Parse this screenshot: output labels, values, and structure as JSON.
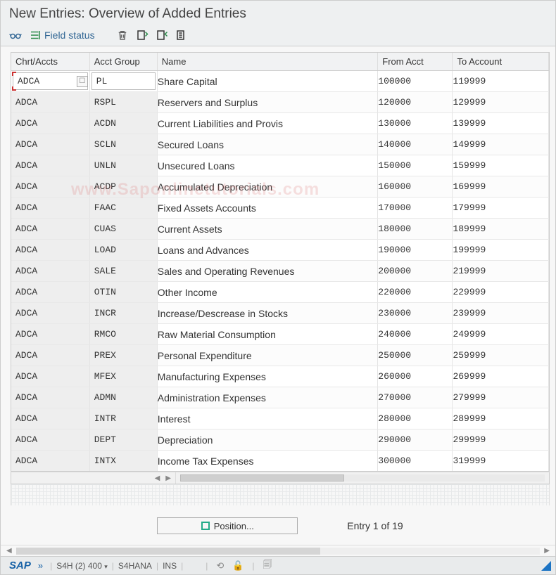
{
  "title": "New Entries: Overview of Added Entries",
  "toolbar": {
    "field_status_label": "Field status"
  },
  "columns": {
    "chrt": "Chrt/Accts",
    "grp": "Acct Group",
    "name": "Name",
    "from": "From Acct",
    "to": "To Account"
  },
  "rows": [
    {
      "chrt": "ADCA",
      "grp": "PL",
      "name": "Share Capital",
      "from": "100000",
      "to": "119999"
    },
    {
      "chrt": "ADCA",
      "grp": "RSPL",
      "name": "Reservers and Surplus",
      "from": "120000",
      "to": "129999"
    },
    {
      "chrt": "ADCA",
      "grp": "ACDN",
      "name": "Current Liabilities and Provis",
      "from": "130000",
      "to": "139999"
    },
    {
      "chrt": "ADCA",
      "grp": "SCLN",
      "name": "Secured Loans",
      "from": "140000",
      "to": "149999"
    },
    {
      "chrt": "ADCA",
      "grp": "UNLN",
      "name": "Unsecured Loans",
      "from": "150000",
      "to": "159999"
    },
    {
      "chrt": "ADCA",
      "grp": "ACDP",
      "name": "Accumulated Depreciation",
      "from": "160000",
      "to": "169999"
    },
    {
      "chrt": "ADCA",
      "grp": "FAAC",
      "name": "Fixed Assets Accounts",
      "from": "170000",
      "to": "179999"
    },
    {
      "chrt": "ADCA",
      "grp": "CUAS",
      "name": "Current Assets",
      "from": "180000",
      "to": "189999"
    },
    {
      "chrt": "ADCA",
      "grp": "LOAD",
      "name": "Loans and Advances",
      "from": "190000",
      "to": "199999"
    },
    {
      "chrt": "ADCA",
      "grp": "SALE",
      "name": "Sales and Operating Revenues",
      "from": "200000",
      "to": "219999"
    },
    {
      "chrt": "ADCA",
      "grp": "OTIN",
      "name": "Other Income",
      "from": "220000",
      "to": "229999"
    },
    {
      "chrt": "ADCA",
      "grp": "INCR",
      "name": "Increase/Descrease in Stocks",
      "from": "230000",
      "to": "239999"
    },
    {
      "chrt": "ADCA",
      "grp": "RMCO",
      "name": "Raw Material Consumption",
      "from": "240000",
      "to": "249999"
    },
    {
      "chrt": "ADCA",
      "grp": "PREX",
      "name": "Personal Expenditure",
      "from": "250000",
      "to": "259999"
    },
    {
      "chrt": "ADCA",
      "grp": "MFEX",
      "name": "Manufacturing Expenses",
      "from": "260000",
      "to": "269999"
    },
    {
      "chrt": "ADCA",
      "grp": "ADMN",
      "name": "Administration Expenses",
      "from": "270000",
      "to": "279999"
    },
    {
      "chrt": "ADCA",
      "grp": "INTR",
      "name": "Interest",
      "from": "280000",
      "to": "289999"
    },
    {
      "chrt": "ADCA",
      "grp": "DEPT",
      "name": "Depreciation",
      "from": "290000",
      "to": "299999"
    },
    {
      "chrt": "ADCA",
      "grp": "INTX",
      "name": "Income Tax Expenses",
      "from": "300000",
      "to": "319999"
    }
  ],
  "position_button": "Position...",
  "entry_counter": "Entry 1 of 19",
  "status": {
    "sap": "SAP",
    "system": "S4H (2) 400",
    "server": "S4HANA",
    "mode": "INS"
  },
  "watermark": "www.Saponlinetutorials.com"
}
